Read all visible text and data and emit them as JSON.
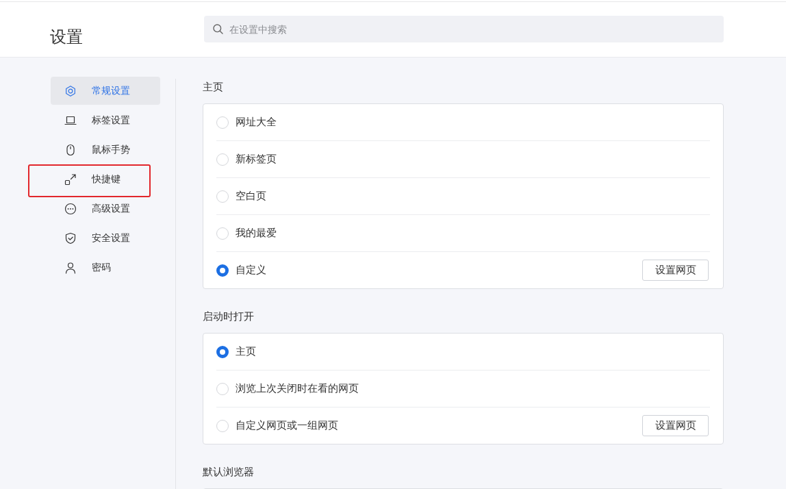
{
  "header": {
    "title": "设置",
    "search": {
      "placeholder": "在设置中搜索"
    }
  },
  "sidebar": {
    "items": [
      {
        "label": "常规设置",
        "kind": "hexagon",
        "selected": true,
        "outlined": false
      },
      {
        "label": "标签设置",
        "kind": "laptop",
        "selected": false,
        "outlined": false
      },
      {
        "label": "鼠标手势",
        "kind": "mouse",
        "selected": false,
        "outlined": false
      },
      {
        "label": "快捷键",
        "kind": "shortcut",
        "selected": false,
        "outlined": true
      },
      {
        "label": "高级设置",
        "kind": "more",
        "selected": false,
        "outlined": false
      },
      {
        "label": "安全设置",
        "kind": "shield",
        "selected": false,
        "outlined": false
      },
      {
        "label": "密码",
        "kind": "person",
        "selected": false,
        "outlined": false
      }
    ]
  },
  "sections": [
    {
      "heading": "主页",
      "options": [
        {
          "label": "网址大全",
          "selected": false
        },
        {
          "label": "新标签页",
          "selected": false
        },
        {
          "label": "空白页",
          "selected": false
        },
        {
          "label": "我的最爱",
          "selected": false
        },
        {
          "label": "自定义",
          "selected": true,
          "button": "设置网页"
        }
      ]
    },
    {
      "heading": "启动时打开",
      "options": [
        {
          "label": "主页",
          "selected": true
        },
        {
          "label": "浏览上次关闭时在看的网页",
          "selected": false
        },
        {
          "label": "自定义网页或一组网页",
          "selected": false,
          "button": "设置网页"
        }
      ]
    },
    {
      "heading": "默认浏览器"
    }
  ]
}
